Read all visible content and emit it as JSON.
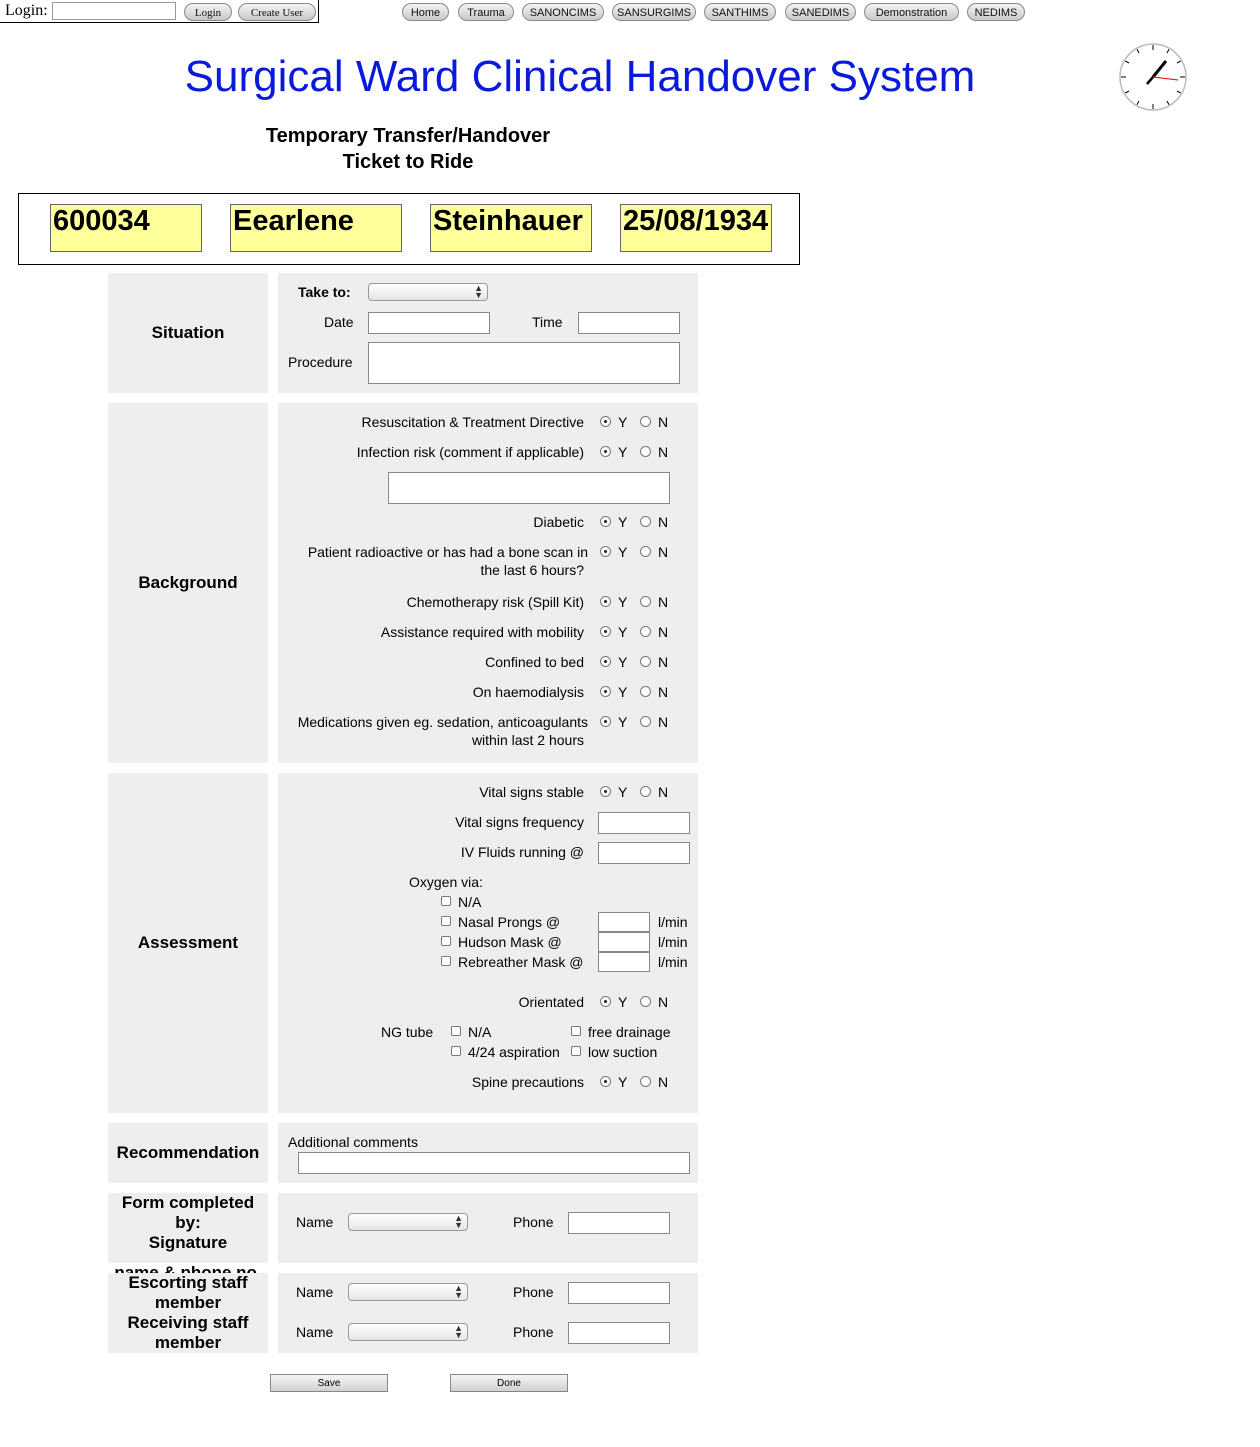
{
  "login": {
    "label": "Login:",
    "username_value": "",
    "login_button": "Login",
    "create_user_button": "Create User"
  },
  "nav": [
    "Home",
    "Trauma",
    "SANONCIMS",
    "SANSURGIMS",
    "SANTHIMS",
    "SANEDIMS",
    "Demonstration",
    "NEDIMS"
  ],
  "title": "Surgical Ward Clinical Handover System",
  "subtitle": {
    "line1": "Temporary Transfer/Handover",
    "line2": "Ticket to Ride"
  },
  "patient": {
    "id": "600034",
    "first_name": "Eearlene",
    "last_name": "Steinhauer",
    "dob": "25/08/1934"
  },
  "situation": {
    "heading": "Situation",
    "take_to_label": "Take to:",
    "take_to_value": "",
    "date_label": "Date",
    "date_value": "",
    "time_label": "Time",
    "time_value": "",
    "procedure_label": "Procedure",
    "procedure_value": ""
  },
  "background": {
    "heading": "Background",
    "yes": "Y",
    "no": "N",
    "q1": "Resuscitation & Treatment Directive",
    "q2": "Infection risk (comment if applicable)",
    "infection_comment": "",
    "q3": "Diabetic",
    "q4a": "Patient radioactive or has had a bone scan in",
    "q4b": "the last 6 hours?",
    "q5": "Chemotherapy risk (Spill Kit)",
    "q6": "Assistance required with mobility",
    "q7": "Confined to bed",
    "q8": "On haemodialysis",
    "q9a": "Medications given eg. sedation, anticoagulants",
    "q9b": "within last 2 hours"
  },
  "assessment": {
    "heading": "Assessment",
    "vital_stable": "Vital signs stable",
    "vital_freq": "Vital signs frequency",
    "vital_freq_value": "",
    "iv_fluids": "IV Fluids running @",
    "iv_fluids_value": "",
    "oxygen_label": "Oxygen via:",
    "oxy_na": "N/A",
    "oxy_nasal": "Nasal Prongs @",
    "oxy_hudson": "Hudson Mask @",
    "oxy_rebreather": "Rebreather Mask @",
    "unit": "l/min",
    "orientated": "Orientated",
    "ng_label": "NG tube",
    "ng_na": "N/A",
    "ng_free": "free drainage",
    "ng_asp": "4/24 aspiration",
    "ng_low": "low suction",
    "spine": "Spine precautions"
  },
  "recommendation": {
    "heading": "Recommendation",
    "comments_label": "Additional comments",
    "comments_value": ""
  },
  "completed": {
    "heading_line1": "Form completed by:",
    "heading_line2": "Signature",
    "heading_line3": "name & phone no.",
    "name_label": "Name",
    "phone_label": "Phone"
  },
  "staff": {
    "escort_line1": "Escorting staff",
    "escort_line2": "member",
    "receive_line1": "Receiving staff",
    "receive_line2": "member",
    "name_label": "Name",
    "phone_label": "Phone"
  },
  "actions": {
    "save": "Save",
    "done": "Done"
  }
}
